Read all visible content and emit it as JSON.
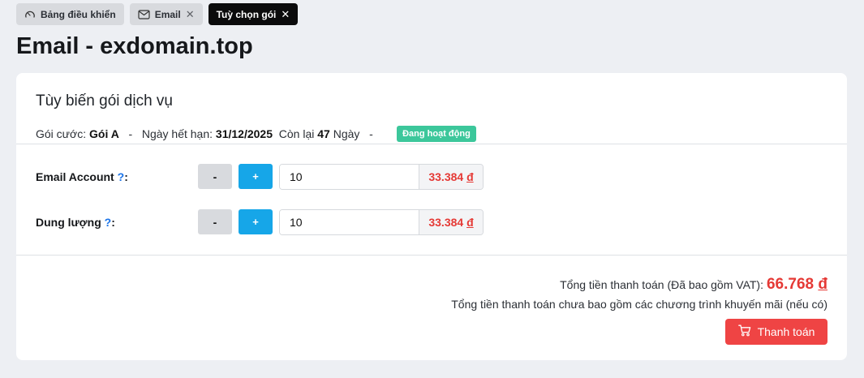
{
  "tabs": [
    {
      "label": "Bảng điều khiển",
      "icon": "gauge-icon",
      "closable": false,
      "active": false
    },
    {
      "label": "Email",
      "icon": "mail-icon",
      "closable": true,
      "active": false
    },
    {
      "label": "Tuỳ chọn gói",
      "closable": true,
      "active": true
    }
  ],
  "tab_close_glyph": "✕",
  "page": {
    "title": "Email - exdomain.top"
  },
  "card": {
    "title": "Tùy biến gói dịch vụ",
    "meta": {
      "plan_label": "Gói cước:",
      "plan_value": "Gói A",
      "sep1": "-",
      "expiry_label": "Ngày hết hạn:",
      "expiry_value": "31/12/2025",
      "remaining_prefix": "Còn lại",
      "remaining_value": "47",
      "remaining_suffix": "Ngày",
      "sep2": "-",
      "status": "Đang hoạt động",
      "status_color": "#3cc79b"
    }
  },
  "options": [
    {
      "label": "Email Account",
      "help": "?",
      "colon": ":",
      "minus": "-",
      "plus": "+",
      "value": "10",
      "price": "33.384",
      "currency": "đ"
    },
    {
      "label": "Dung lượng",
      "help": "?",
      "colon": ":",
      "minus": "-",
      "plus": "+",
      "value": "10",
      "price": "33.384",
      "currency": "đ"
    }
  ],
  "summary": {
    "total_label": "Tổng tiền thanh toán (Đã bao gồm VAT):",
    "total_value": "66.768",
    "currency": "đ",
    "note": "Tổng tiền thanh toán chưa bao gồm các chương trình khuyến mãi (nếu có)",
    "pay_button": "Thanh toán"
  },
  "colors": {
    "accent_blue": "#16a6e8",
    "price_red": "#e53935",
    "pay_red": "#ef4444",
    "dark_tab": "#0b0b0c"
  }
}
